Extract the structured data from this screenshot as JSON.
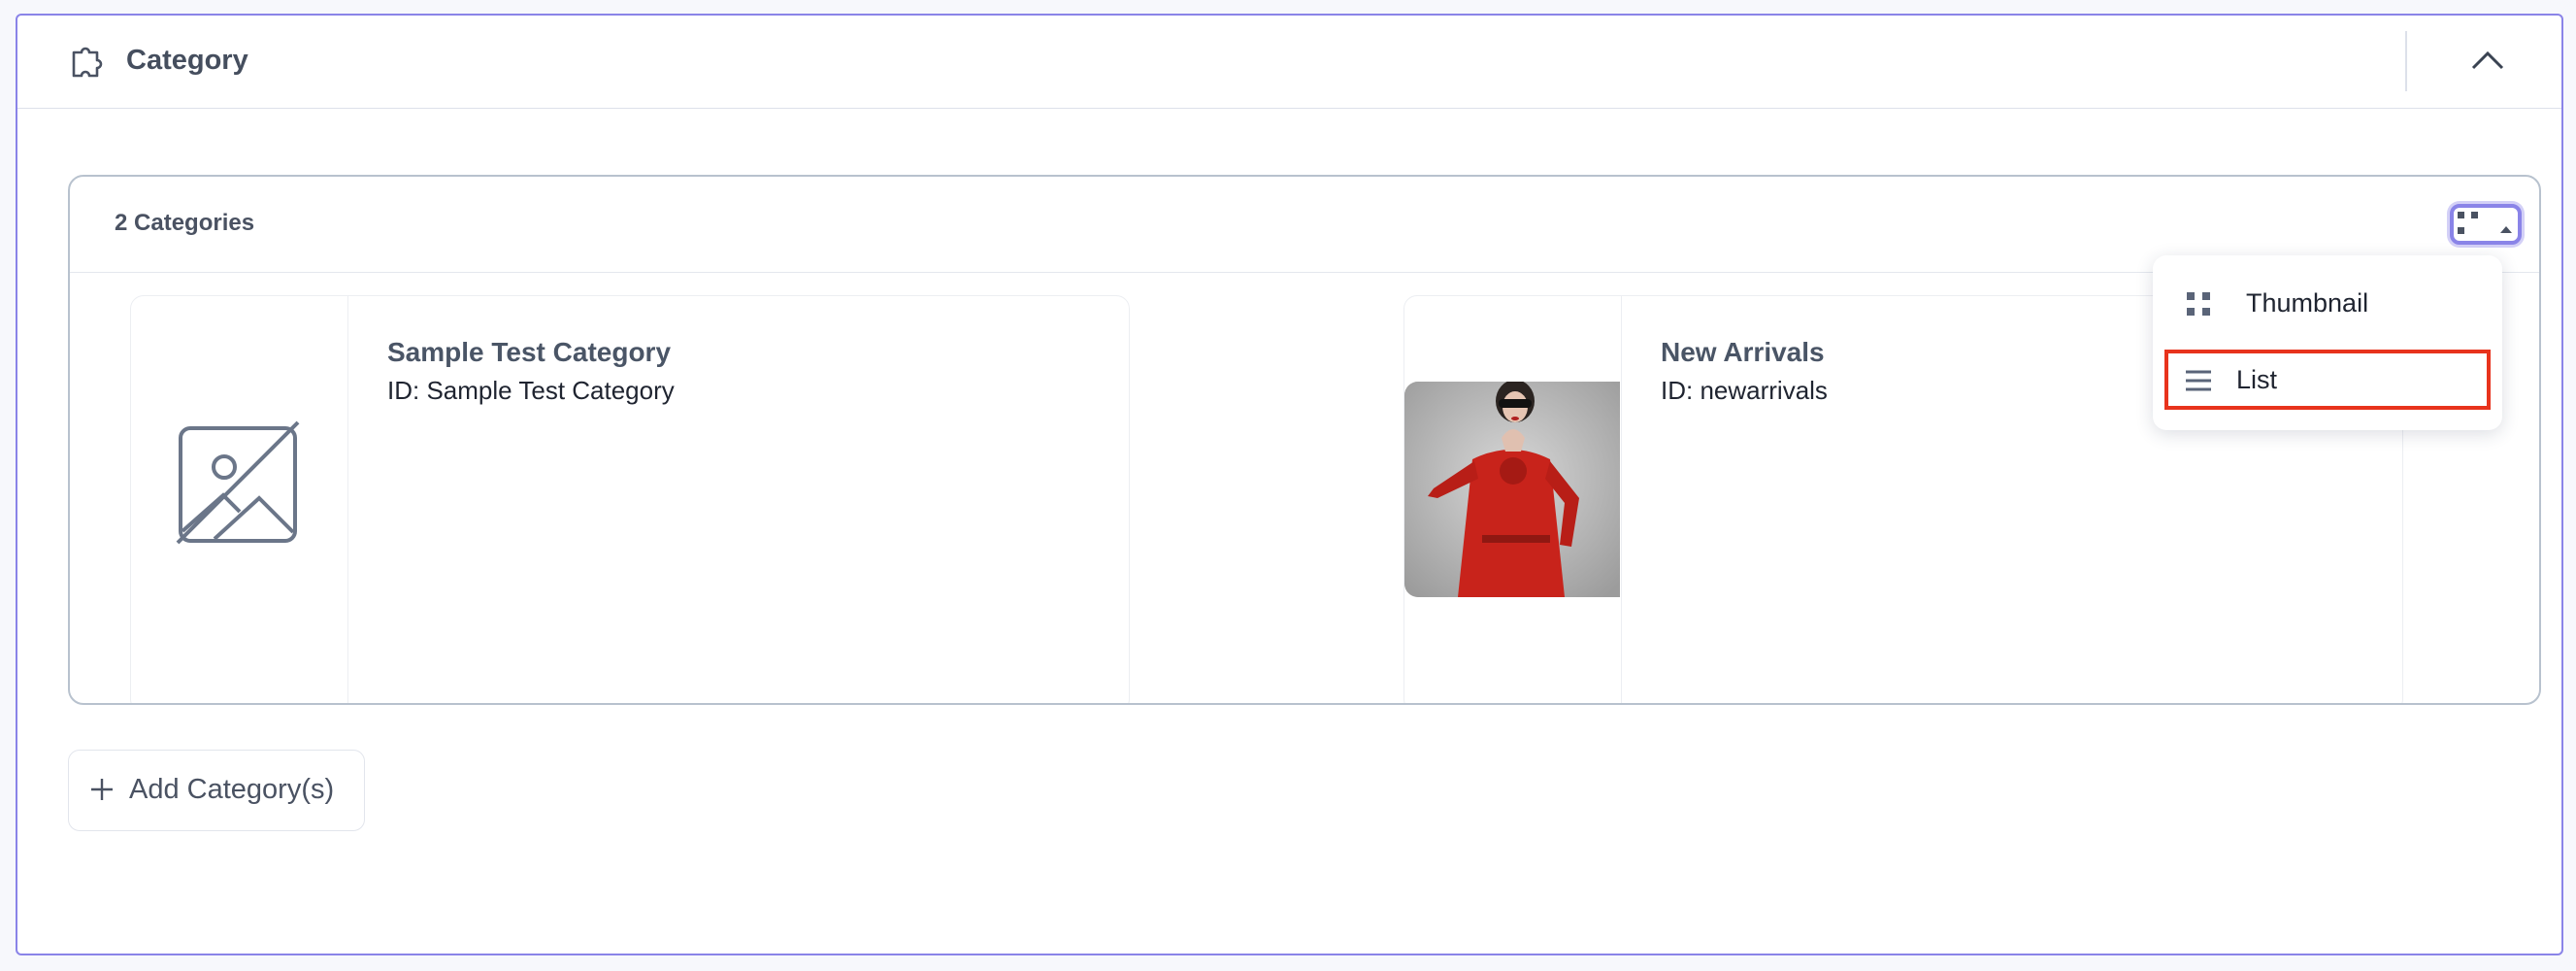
{
  "section": {
    "title": "Category",
    "icon": "puzzle-icon",
    "collapse_icon": "chevron-up-icon"
  },
  "categories": {
    "count_label": "2 Categories",
    "view_toggle_icon": "grid-view-icon",
    "items": [
      {
        "name": "Sample Test Category",
        "id_label": "ID: Sample Test Category",
        "thumbnail": "image-placeholder-icon"
      },
      {
        "name": "New Arrivals",
        "id_label": "ID: newarrivals",
        "thumbnail": "photo-woman-red-coat"
      }
    ]
  },
  "view_menu": {
    "items": [
      {
        "label": "Thumbnail",
        "icon": "grid-icon",
        "selected": false
      },
      {
        "label": "List",
        "icon": "list-icon",
        "selected": true
      }
    ]
  },
  "actions": {
    "add_label": "Add Category(s)",
    "add_icon": "plus-icon"
  },
  "colors": {
    "accent": "#8a84e8",
    "highlight": "#e8331c",
    "text": "#3a4352"
  }
}
